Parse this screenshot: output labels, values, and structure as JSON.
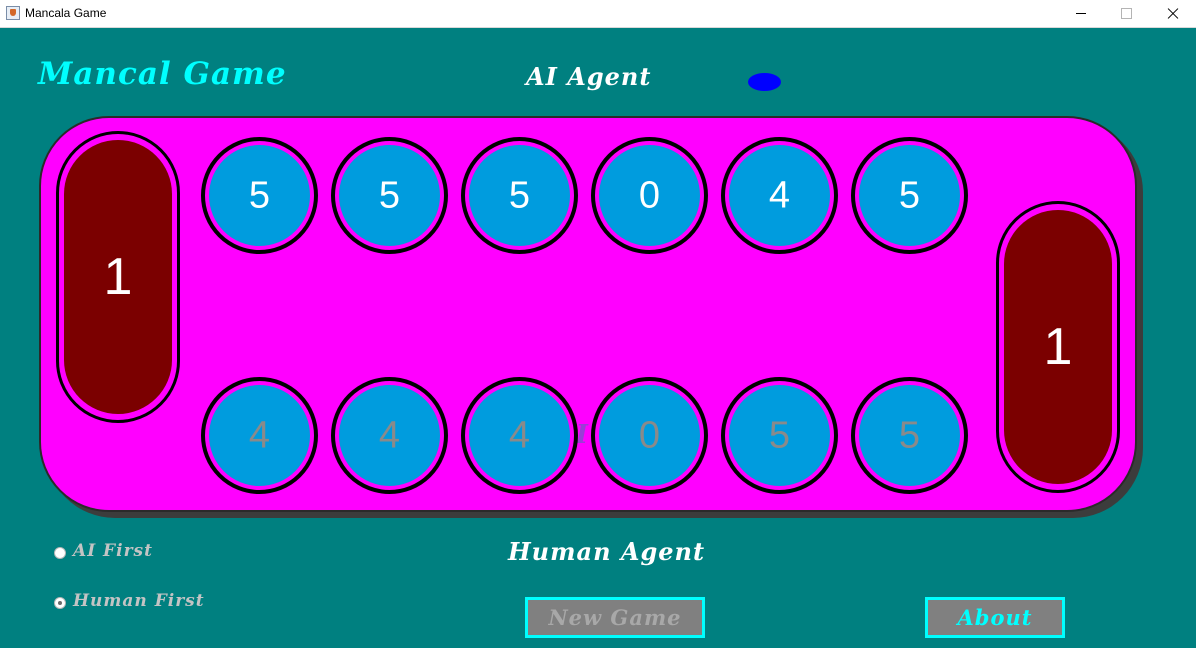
{
  "window": {
    "title": "Mancala Game"
  },
  "header": {
    "game_title": "Mancal Game",
    "ai_agent_label": "AI Agent",
    "human_agent_label": "Human Agent"
  },
  "board": {
    "ai_store": "1",
    "human_store": "1",
    "ai_pits": [
      "5",
      "5",
      "5",
      "0",
      "4",
      "5"
    ],
    "human_pits": [
      "4",
      "4",
      "4",
      "0",
      "5",
      "5"
    ],
    "turn_text": "AI Turn"
  },
  "options": {
    "ai_first_label": "AI First",
    "human_first_label": "Human First",
    "selected": "Human First"
  },
  "buttons": {
    "new_game": "New Game",
    "about": "About"
  },
  "colors": {
    "background": "#008080",
    "board": "#ff00ff",
    "pit": "#009cde",
    "store": "#7b0000",
    "turn_indicator": "#0000ff",
    "accent": "#00ffff"
  }
}
